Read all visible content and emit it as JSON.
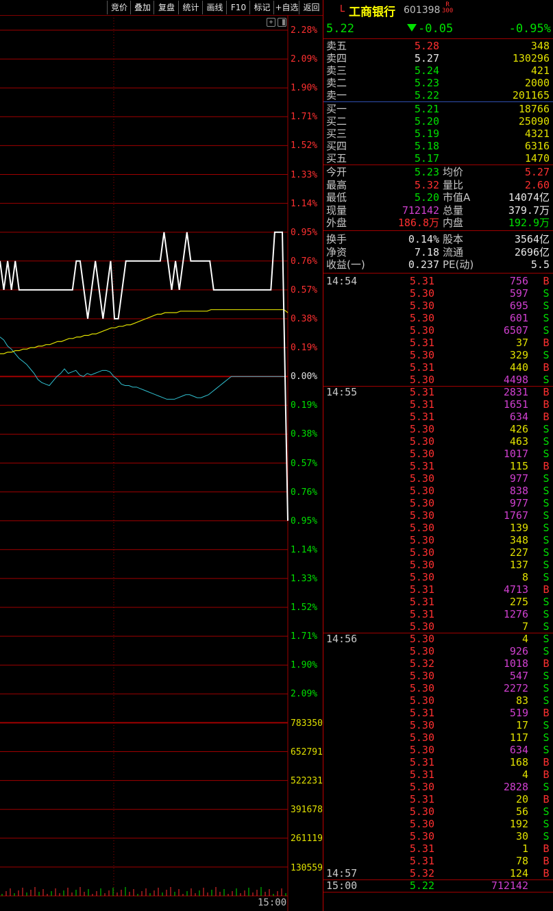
{
  "toolbar": [
    "竞价",
    "叠加",
    "复盘",
    "统计",
    "画线",
    "F10",
    "标记",
    "+自选",
    "返回"
  ],
  "stock": {
    "flag": "L",
    "name": "工商银行",
    "code": "601398",
    "badge_top": "R",
    "badge_bottom": "300",
    "price": "5.22",
    "change": "-0.05",
    "change_pct": "-0.95%"
  },
  "price_axis": [
    {
      "text": "2.28%",
      "dir": "up"
    },
    {
      "text": "2.09%",
      "dir": "up"
    },
    {
      "text": "1.90%",
      "dir": "up"
    },
    {
      "text": "1.71%",
      "dir": "up"
    },
    {
      "text": "1.52%",
      "dir": "up"
    },
    {
      "text": "1.33%",
      "dir": "up"
    },
    {
      "text": "1.14%",
      "dir": "up"
    },
    {
      "text": "0.95%",
      "dir": "up"
    },
    {
      "text": "0.76%",
      "dir": "up"
    },
    {
      "text": "0.57%",
      "dir": "up"
    },
    {
      "text": "0.38%",
      "dir": "up"
    },
    {
      "text": "0.19%",
      "dir": "up"
    },
    {
      "text": "0.00%",
      "dir": "flat"
    },
    {
      "text": "0.19%",
      "dir": "down"
    },
    {
      "text": "0.38%",
      "dir": "down"
    },
    {
      "text": "0.57%",
      "dir": "down"
    },
    {
      "text": "0.76%",
      "dir": "down"
    },
    {
      "text": "0.95%",
      "dir": "down"
    },
    {
      "text": "1.14%",
      "dir": "down"
    },
    {
      "text": "1.33%",
      "dir": "down"
    },
    {
      "text": "1.52%",
      "dir": "down"
    },
    {
      "text": "1.71%",
      "dir": "down"
    },
    {
      "text": "1.90%",
      "dir": "down"
    },
    {
      "text": "2.09%",
      "dir": "down"
    }
  ],
  "volume_axis": [
    "783350",
    "652791",
    "522231",
    "391678",
    "261119",
    "130559"
  ],
  "time_label": "15:00",
  "asks": [
    {
      "label": "卖五",
      "price": "5.28",
      "vol": "348",
      "dir": "up"
    },
    {
      "label": "卖四",
      "price": "5.27",
      "vol": "130296",
      "dir": "flat"
    },
    {
      "label": "卖三",
      "price": "5.24",
      "vol": "421",
      "dir": "down"
    },
    {
      "label": "卖二",
      "price": "5.23",
      "vol": "2000",
      "dir": "down"
    },
    {
      "label": "卖一",
      "price": "5.22",
      "vol": "201165",
      "dir": "down"
    }
  ],
  "bids": [
    {
      "label": "买一",
      "price": "5.21",
      "vol": "18766",
      "dir": "down"
    },
    {
      "label": "买二",
      "price": "5.20",
      "vol": "25090",
      "dir": "down"
    },
    {
      "label": "买三",
      "price": "5.19",
      "vol": "4321",
      "dir": "down"
    },
    {
      "label": "买四",
      "price": "5.18",
      "vol": "6316",
      "dir": "down"
    },
    {
      "label": "买五",
      "price": "5.17",
      "vol": "1470",
      "dir": "down"
    }
  ],
  "stats1": [
    {
      "l1": "今开",
      "v1": "5.23",
      "c1": "down",
      "l2": "均价",
      "v2": "5.27",
      "c2": "up"
    },
    {
      "l1": "最高",
      "v1": "5.32",
      "c1": "up",
      "l2": "量比",
      "v2": "2.60",
      "c2": "up"
    },
    {
      "l1": "最低",
      "v1": "5.20",
      "c1": "down",
      "l2": "市值A",
      "v2": "14074亿",
      "c2": "white"
    },
    {
      "l1": "现量",
      "v1": "712142",
      "c1": "purple",
      "l2": "总量",
      "v2": "379.7万",
      "c2": "white"
    },
    {
      "l1": "外盘",
      "v1": "186.8万",
      "c1": "up",
      "l2": "内盘",
      "v2": "192.9万",
      "c2": "green"
    }
  ],
  "stats2": [
    {
      "l1": "换手",
      "v1": "0.14%",
      "l2": "股本",
      "v2": "3564亿"
    },
    {
      "l1": "净资",
      "v1": "7.18",
      "l2": "流通",
      "v2": "2696亿"
    },
    {
      "l1": "收益(一)",
      "v1": "0.237",
      "l2": "PE(动)",
      "v2": "5.5"
    }
  ],
  "ticks": [
    {
      "time": "14:54",
      "price": "5.31",
      "vol": "756",
      "bs": "B"
    },
    {
      "time": "",
      "price": "5.30",
      "vol": "597",
      "bs": "S"
    },
    {
      "time": "",
      "price": "5.30",
      "vol": "695",
      "bs": "S"
    },
    {
      "time": "",
      "price": "5.30",
      "vol": "601",
      "bs": "S"
    },
    {
      "time": "",
      "price": "5.30",
      "vol": "6507",
      "bs": "S"
    },
    {
      "time": "",
      "price": "5.31",
      "vol": "37",
      "bs": "B"
    },
    {
      "time": "",
      "price": "5.30",
      "vol": "329",
      "bs": "S"
    },
    {
      "time": "",
      "price": "5.31",
      "vol": "440",
      "bs": "B"
    },
    {
      "time": "",
      "price": "5.30",
      "vol": "4498",
      "bs": "S"
    },
    {
      "time": "14:55",
      "price": "5.31",
      "vol": "2831",
      "bs": "B"
    },
    {
      "time": "",
      "price": "5.31",
      "vol": "1651",
      "bs": "B"
    },
    {
      "time": "",
      "price": "5.31",
      "vol": "634",
      "bs": "B"
    },
    {
      "time": "",
      "price": "5.30",
      "vol": "426",
      "bs": "S"
    },
    {
      "time": "",
      "price": "5.30",
      "vol": "463",
      "bs": "S"
    },
    {
      "time": "",
      "price": "5.30",
      "vol": "1017",
      "bs": "S"
    },
    {
      "time": "",
      "price": "5.31",
      "vol": "115",
      "bs": "B"
    },
    {
      "time": "",
      "price": "5.30",
      "vol": "977",
      "bs": "S"
    },
    {
      "time": "",
      "price": "5.30",
      "vol": "838",
      "bs": "S"
    },
    {
      "time": "",
      "price": "5.30",
      "vol": "977",
      "bs": "S"
    },
    {
      "time": "",
      "price": "5.30",
      "vol": "1767",
      "bs": "S"
    },
    {
      "time": "",
      "price": "5.30",
      "vol": "139",
      "bs": "S"
    },
    {
      "time": "",
      "price": "5.30",
      "vol": "348",
      "bs": "S"
    },
    {
      "time": "",
      "price": "5.30",
      "vol": "227",
      "bs": "S"
    },
    {
      "time": "",
      "price": "5.30",
      "vol": "137",
      "bs": "S"
    },
    {
      "time": "",
      "price": "5.30",
      "vol": "8",
      "bs": "S"
    },
    {
      "time": "",
      "price": "5.31",
      "vol": "4713",
      "bs": "B"
    },
    {
      "time": "",
      "price": "5.31",
      "vol": "275",
      "bs": "S"
    },
    {
      "time": "",
      "price": "5.31",
      "vol": "1276",
      "bs": "S"
    },
    {
      "time": "",
      "price": "5.30",
      "vol": "7",
      "bs": "S"
    },
    {
      "time": "14:56",
      "price": "5.30",
      "vol": "4",
      "bs": "S"
    },
    {
      "time": "",
      "price": "5.30",
      "vol": "926",
      "bs": "S"
    },
    {
      "time": "",
      "price": "5.32",
      "vol": "1018",
      "bs": "B"
    },
    {
      "time": "",
      "price": "5.30",
      "vol": "547",
      "bs": "S"
    },
    {
      "time": "",
      "price": "5.30",
      "vol": "2272",
      "bs": "S"
    },
    {
      "time": "",
      "price": "5.30",
      "vol": "83",
      "bs": "S"
    },
    {
      "time": "",
      "price": "5.31",
      "vol": "519",
      "bs": "B"
    },
    {
      "time": "",
      "price": "5.30",
      "vol": "17",
      "bs": "S"
    },
    {
      "time": "",
      "price": "5.30",
      "vol": "117",
      "bs": "S"
    },
    {
      "time": "",
      "price": "5.30",
      "vol": "634",
      "bs": "S"
    },
    {
      "time": "",
      "price": "5.31",
      "vol": "168",
      "bs": "B"
    },
    {
      "time": "",
      "price": "5.31",
      "vol": "4",
      "bs": "B"
    },
    {
      "time": "",
      "price": "5.30",
      "vol": "2828",
      "bs": "S"
    },
    {
      "time": "",
      "price": "5.31",
      "vol": "20",
      "bs": "B"
    },
    {
      "time": "",
      "price": "5.30",
      "vol": "56",
      "bs": "S"
    },
    {
      "time": "",
      "price": "5.30",
      "vol": "192",
      "bs": "S"
    },
    {
      "time": "",
      "price": "5.30",
      "vol": "30",
      "bs": "S"
    },
    {
      "time": "",
      "price": "5.31",
      "vol": "1",
      "bs": "B"
    },
    {
      "time": "",
      "price": "5.31",
      "vol": "78",
      "bs": "B"
    },
    {
      "time": "14:57",
      "price": "5.32",
      "vol": "124",
      "bs": "B"
    },
    {
      "time": "15:00",
      "price": "5.22",
      "vol": "712142",
      "bs": ""
    }
  ],
  "chart_data": {
    "type": "line",
    "price_pct": [
      0.76,
      0.57,
      0.76,
      0.57,
      0.76,
      0.57,
      0.57,
      0.57,
      0.57,
      0.57,
      0.57,
      0.57,
      0.57,
      0.57,
      0.57,
      0.57,
      0.57,
      0.57,
      0.57,
      0.57,
      0.76,
      0.76,
      0.57,
      0.38,
      0.57,
      0.76,
      0.57,
      0.38,
      0.57,
      0.76,
      0.38,
      0.38,
      0.57,
      0.76,
      0.76,
      0.76,
      0.76,
      0.76,
      0.76,
      0.76,
      0.76,
      0.76,
      0.76,
      0.95,
      0.76,
      0.57,
      0.76,
      0.57,
      0.76,
      0.95,
      0.76,
      0.76,
      0.76,
      0.76,
      0.76,
      0.76,
      0.57,
      0.57,
      0.57,
      0.57,
      0.57,
      0.57,
      0.57,
      0.57,
      0.57,
      0.57,
      0.57,
      0.57,
      0.57,
      0.57,
      0.57,
      0.57,
      0.95,
      0.95,
      0.95,
      -0.95
    ],
    "avg_pct": [
      0.15,
      0.15,
      0.16,
      0.16,
      0.17,
      0.17,
      0.18,
      0.18,
      0.19,
      0.19,
      0.2,
      0.2,
      0.21,
      0.21,
      0.22,
      0.23,
      0.23,
      0.24,
      0.25,
      0.25,
      0.26,
      0.26,
      0.27,
      0.27,
      0.28,
      0.28,
      0.29,
      0.3,
      0.31,
      0.32,
      0.32,
      0.33,
      0.33,
      0.34,
      0.34,
      0.35,
      0.36,
      0.37,
      0.38,
      0.39,
      0.4,
      0.41,
      0.41,
      0.42,
      0.42,
      0.42,
      0.42,
      0.43,
      0.43,
      0.43,
      0.43,
      0.43,
      0.43,
      0.43,
      0.43,
      0.44,
      0.44,
      0.44,
      0.44,
      0.44,
      0.44,
      0.44,
      0.44,
      0.44,
      0.44,
      0.44,
      0.44,
      0.44,
      0.44,
      0.44,
      0.44,
      0.44,
      0.44,
      0.44,
      0.44,
      0.42
    ],
    "blue_pct": [
      0.26,
      0.24,
      0.2,
      0.18,
      0.15,
      0.12,
      0.1,
      0.08,
      0.05,
      0.02,
      -0.02,
      -0.04,
      -0.05,
      -0.06,
      -0.03,
      0.0,
      0.02,
      0.05,
      0.02,
      0.03,
      0.04,
      0.01,
      0.0,
      0.02,
      0.01,
      0.02,
      0.03,
      0.04,
      0.04,
      0.03,
      0.0,
      -0.02,
      -0.05,
      -0.06,
      -0.06,
      -0.07,
      -0.07,
      -0.08,
      -0.09,
      -0.1,
      -0.11,
      -0.12,
      -0.13,
      -0.14,
      -0.15,
      -0.15,
      -0.15,
      -0.14,
      -0.13,
      -0.12,
      -0.12,
      -0.13,
      -0.14,
      -0.14,
      -0.13,
      -0.12,
      -0.1,
      -0.08,
      -0.06,
      -0.04,
      -0.02,
      0.0,
      0.0,
      0.0,
      0.0,
      0.0,
      0.0,
      0.0,
      0.0,
      0.0,
      0.0,
      0.0,
      0.0,
      0.0,
      0.0,
      0.0
    ],
    "ylim_pct": [
      -2.28,
      2.28
    ]
  }
}
